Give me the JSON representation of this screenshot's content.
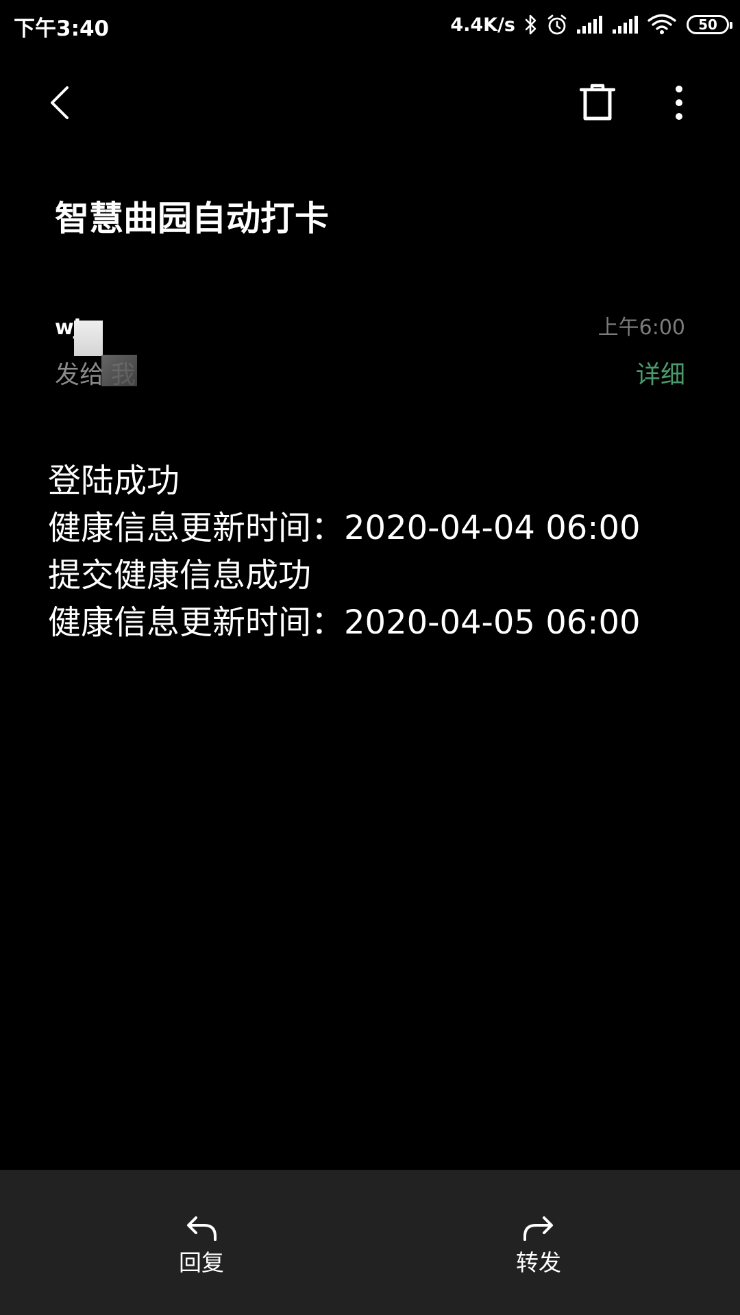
{
  "status_bar": {
    "time": "下午3:40",
    "net_speed": "4.4K/s",
    "battery_level": "50",
    "icons": [
      "bluetooth-icon",
      "alarm-icon",
      "signal-icon",
      "signal-icon",
      "wifi-icon",
      "battery-icon"
    ]
  },
  "toolbar": {
    "icons": [
      "back-icon",
      "trash-icon",
      "more-vertical-icon"
    ]
  },
  "email": {
    "subject": "智慧曲园自动打卡",
    "sender": "wj",
    "recipient_prefix": "发给",
    "recipient": "我",
    "time": "上午6:00",
    "detail_label": "详细",
    "body_lines": [
      "登陆成功",
      "健康信息更新时间：2020-04-04 06:00",
      "提交健康信息成功",
      "健康信息更新时间：2020-04-05 06:00"
    ]
  },
  "bottom_bar": {
    "reply_label": "回复",
    "forward_label": "转发",
    "icons": [
      "reply-icon",
      "forward-icon"
    ]
  },
  "colors": {
    "background": "#000000",
    "text": "#ffffff",
    "secondary_text": "#8a8a8a",
    "accent": "#4a9a6c",
    "bottom_bar": "#222222"
  }
}
